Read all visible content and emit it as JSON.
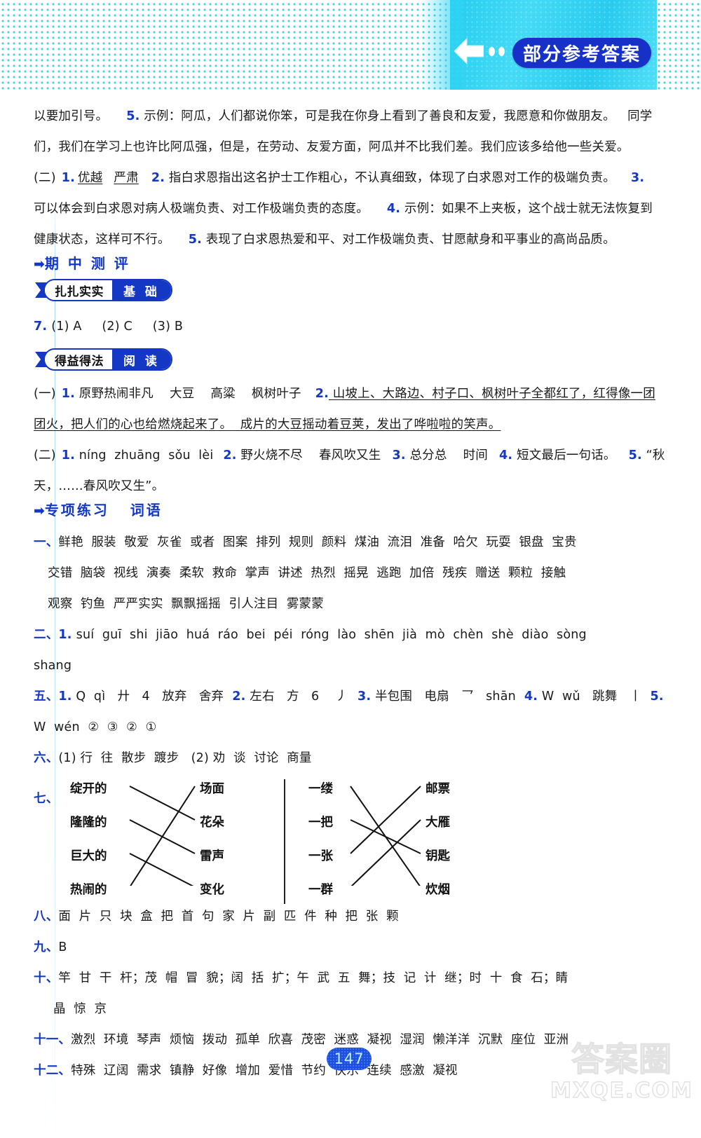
{
  "header": {
    "badge_label": "部分参考答案",
    "back_icon": "left-arrow-icon",
    "accent_cyan": "#2fd4f2",
    "accent_blue": "#1730c8"
  },
  "content": {
    "line_1": "以要加引号。    5. 示例：阿瓜，人们都说你笨，可是我在你身上看到了善良和友爱，我愿意和你做朋友。    同学",
    "line_1_plain": "以要加引号。",
    "line_1_num": "5.",
    "line_1_rest": " 示例：阿瓜，人们都说你笨，可是我在你身上看到了善良和友爱，我愿意和你做朋友。   同学",
    "line_2": "们，我们在学习上也许比阿瓜强，但是，在劳动、友爱方面，阿瓜并不比我们差。我们应该多给他一些关爱。",
    "line_3_label": "(二)",
    "line_3_n1": "1.",
    "line_3_u1": "优越",
    "line_3_u2": "严肃",
    "line_3_n2": "2.",
    "line_3_t2": " 指白求恩指出这名护士工作粗心，不认真细致，体现了白求恩对工作的极端负责。",
    "line_3_n3": "3.",
    "line_4": "可以体会到白求恩对病人极端负责、对工作极端负责的态度。",
    "line_4_n4": "4.",
    "line_4_t4": " 示例：如果不上夹板，这个战士就无法恢复到",
    "line_5": "健康状态，这样可不行。",
    "line_5_n5": "5.",
    "line_5_t5": " 表现了白求恩热爱和平、对工作极端负责、甘愿献身和平事业的高尚品质。"
  },
  "sections": {
    "midterm": {
      "arrow": "➡",
      "title": "期 中 测 评"
    },
    "special": {
      "arrow": "➡",
      "title": "专项练习   词语"
    }
  },
  "pills": [
    {
      "left": "扎扎实实",
      "right": "基 础"
    },
    {
      "left": "得益得法",
      "right": "阅 读"
    }
  ],
  "midterm_answers": {
    "q7_num": "7.",
    "q7_text": "(1) A     (2) C     (3) B"
  },
  "reading": {
    "group1_label": "(一)",
    "g1_n1": "1.",
    "g1_t1": " 原野热闹非凡    大豆    高粱    枫树叶子",
    "g1_n2": "2.",
    "g1_t2_a": " 山坡上、大路边、村子口、枫树叶子全都红了，红得像一团",
    "g1_t2_b": "团火，把人们的心也给燃烧起来了。",
    "g1_t2_c": "  成片的大豆摇动着豆荚，发出了哗啦啦的笑声。",
    "group2_label": "(二)",
    "g2_n1": "1.",
    "g2_t1": " níng  zhuāng  sǒu  lèi",
    "g2_n2": "2.",
    "g2_t2": " 野火烧不尽    春风吹又生",
    "g2_n3": "3.",
    "g2_t3": " 总分总    时间",
    "g2_n4": "4.",
    "g2_t4": " 短文最后一句话。",
    "g2_n5": "5.",
    "g2_t5": " “秋",
    "g2_t5_b": "天，……春风吹又生”。"
  },
  "vocab": {
    "row1_label": "一、",
    "row1_line1": "鲜艳  服装  敬爱  灰雀  或者  图案  排列  规则  颜料  煤油  流泪  准备  哈欠  玩耍  银盘  宝贵",
    "row1_line2": "交错  脑袋  视线  演奏  柔软  救命  掌声  讲述  热烈  摇晃  逃跑  加倍  残疾  赠送  颗粒  接触",
    "row1_line3": "观察  钓鱼  严严实实  飘飘摇摇  引人注目  雾蒙蒙",
    "row2_label": "二、",
    "row2_num": "1.",
    "row2_line1": "suí  guī  shi  jiāo  huá  ráo  bei  péi  róng  lào  shēn  jià  mò  chèn  shè  diào  sòng",
    "row2_line2": "shang",
    "row5_label": "五、",
    "row5_n1": "1.",
    "row5_t1": " Q  qì   廾   4   放弃   舍弃",
    "row5_n2": "2.",
    "row5_t2": " 左右   方   6    丿",
    "row5_n3": "3.",
    "row5_t3": " 半包围   电扇   乛   shān",
    "row5_n4": "4.",
    "row5_t4": " W  wǔ   跳舞   丨",
    "row5_n5": "5.",
    "row5_line2": "W  wén  ②  ③  ②  ①",
    "row6_label": "六、",
    "row6_text": "(1) 行  往  散步  踱步   (2) 劝  谈  讨论  商量",
    "row8_label": "八、",
    "row8_text": "面  片  只  块  盒  把  首  句  家  片  副  匹  件  种  把  张  颗",
    "row9_label": "九、",
    "row9_text": "B",
    "row10_label": "十、",
    "row10_line1": "竿  甘  干  杆；茂  帽  冒  貌；阔  括  扩；午  武  五  舞；技  记  计  继；时  十  食  石；睛",
    "row10_line2": "晶  惊  京",
    "row11_label": "十一、",
    "row11_text": "激烈  环境  琴声  烦恼  拨动  孤单  欣喜  茂密  迷惑  凝视  湿润  懒洋洋  沉默  座位  亚洲",
    "row12_label": "十二、",
    "row12_text": "特殊  辽阔  需求  镇静  好像  增加  爱惜  节约  快乐  连续  感激  凝视"
  },
  "matching": {
    "label": "七、",
    "left_group": {
      "left_items": [
        "绽开的",
        "隆隆的",
        "巨大的",
        "热闹的"
      ],
      "right_items": [
        "场面",
        "花朵",
        "雷声",
        "变化"
      ],
      "pairs": [
        [
          0,
          1
        ],
        [
          1,
          2
        ],
        [
          2,
          3
        ],
        [
          3,
          0
        ]
      ]
    },
    "right_group": {
      "left_items": [
        "一缕",
        "一把",
        "一张",
        "一群"
      ],
      "right_items": [
        "邮票",
        "大雁",
        "钥匙",
        "炊烟"
      ],
      "pairs": [
        [
          0,
          3
        ],
        [
          1,
          2
        ],
        [
          2,
          0
        ],
        [
          3,
          1
        ]
      ]
    }
  },
  "footer": {
    "page_number": "147",
    "watermark_cn": "答案圈",
    "watermark_en": "MXQE.COM"
  }
}
